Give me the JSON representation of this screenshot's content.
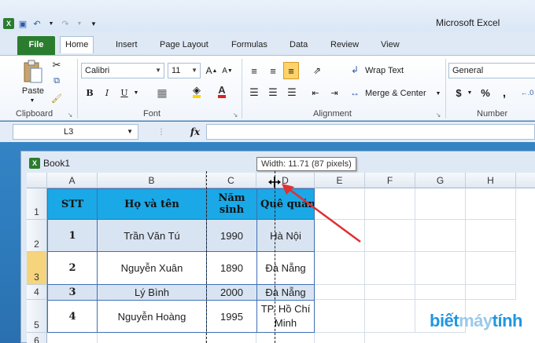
{
  "app": {
    "title": "Microsoft Excel"
  },
  "tabs": {
    "file": "File",
    "home": "Home",
    "insert": "Insert",
    "page_layout": "Page Layout",
    "formulas": "Formulas",
    "data": "Data",
    "review": "Review",
    "view": "View"
  },
  "ribbon": {
    "clipboard": {
      "paste": "Paste",
      "label": "Clipboard"
    },
    "font": {
      "name": "Calibri",
      "size": "11",
      "bold": "B",
      "italic": "I",
      "underline": "U",
      "label": "Font"
    },
    "alignment": {
      "wrap_text": "Wrap Text",
      "merge_center": "Merge & Center",
      "label": "Alignment"
    },
    "number": {
      "format": "General",
      "currency": "$",
      "percent": "%",
      "comma": ",",
      "label": "Number"
    }
  },
  "formula_bar": {
    "name_box": "L3",
    "fx": "fx",
    "value": ""
  },
  "workbook": {
    "title": "Book1"
  },
  "tooltip": "Width: 11.71 (87 pixels)",
  "columns": [
    "A",
    "B",
    "C",
    "D",
    "E",
    "F",
    "G",
    "H"
  ],
  "rows": [
    "1",
    "2",
    "3",
    "4",
    "5",
    "6"
  ],
  "table": {
    "header": [
      "STT",
      "Họ và tên",
      "Năm sinh",
      "Quê quán"
    ],
    "rows": [
      [
        "1",
        "Trần Văn Tú",
        "1990",
        "Hà Nội"
      ],
      [
        "2",
        "Nguyễn Xuân",
        "1890",
        "Đà Nẵng"
      ],
      [
        "3",
        "Lý Bình",
        "2000",
        "Đà Nẵng"
      ],
      [
        "4",
        "Nguyễn Hoàng",
        "1995",
        "TP. Hồ Chí Minh"
      ]
    ]
  },
  "watermark": {
    "part1": "biết",
    "part2": "máy",
    "part3": "tính"
  },
  "colors": {
    "header_fill": "#1aa8e6",
    "alt_fill": "#d9e4f2",
    "file_tab": "#2a7d2e",
    "arrow": "#e03030"
  }
}
